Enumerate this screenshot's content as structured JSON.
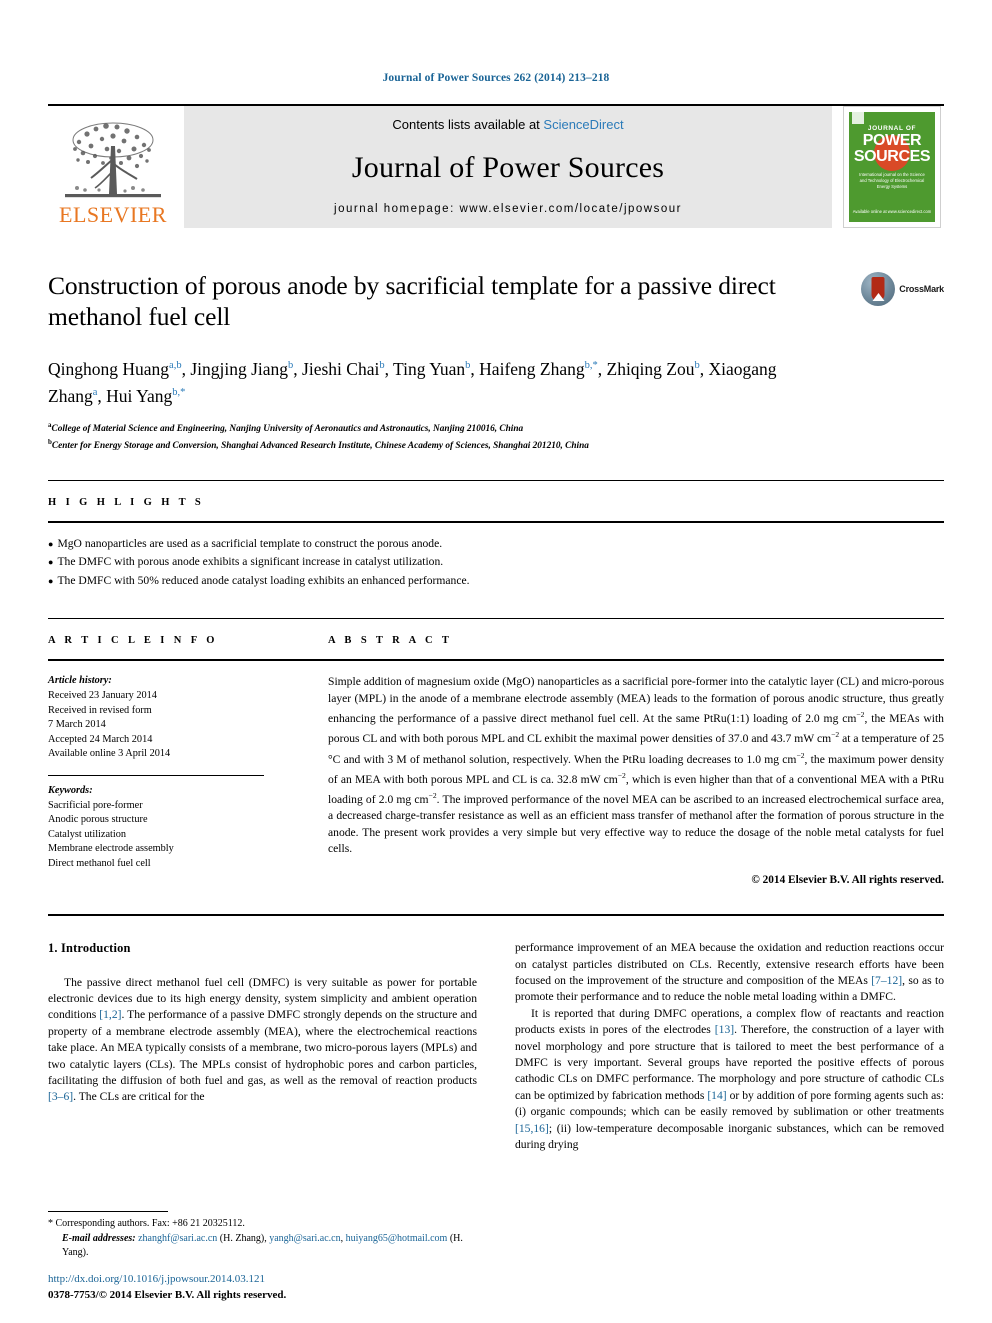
{
  "running_head": "Journal of Power Sources 262 (2014) 213–218",
  "masthead": {
    "contents_prefix": "Contents lists available at ",
    "sciencedirect": "ScienceDirect",
    "journal_name": "Journal of Power Sources",
    "homepage": "journal homepage: www.elsevier.com/locate/jpowsour",
    "publisher": "ELSEVIER",
    "cover": {
      "journal_of": "JOURNAL OF",
      "power": "POWER",
      "sources": "SOURCES",
      "subtitle": "International journal on the Science and Technology of Electrochemical Energy Systems",
      "footer": "Available online at www.sciencedirect.com"
    }
  },
  "crossmark": {
    "label": "CrossMark"
  },
  "article": {
    "title": "Construction of porous anode by sacrificial template for a passive direct methanol fuel cell",
    "authors_line1": "Qinghong Huang",
    "authors_html_note": "authors rendered from parts",
    "author_parts": [
      {
        "name": "Qinghong Huang",
        "sup": "a,b",
        "sep": ", "
      },
      {
        "name": "Jingjing Jiang",
        "sup": "b",
        "sep": ", "
      },
      {
        "name": "Jieshi Chai",
        "sup": "b",
        "sep": ", "
      },
      {
        "name": "Ting Yuan",
        "sup": "b",
        "sep": ", "
      },
      {
        "name": "Haifeng Zhang",
        "sup": "b,*",
        "sep": ", "
      },
      {
        "name": "Zhiqing Zou",
        "sup": "b",
        "sep": ", "
      },
      {
        "name": "Xiaogang Zhang",
        "sup": "a",
        "sep": ", "
      },
      {
        "name": "Hui Yang",
        "sup": "b,*",
        "sep": ""
      }
    ],
    "affiliation_a": "College of Material Science and Engineering, Nanjing University of Aeronautics and Astronautics, Nanjing 210016, China",
    "affiliation_a_sup": "a",
    "affiliation_b": "Center for Energy Storage and Conversion, Shanghai Advanced Research Institute, Chinese Academy of Sciences, Shanghai 201210, China",
    "affiliation_b_sup": "b"
  },
  "highlights": {
    "heading": "H I G H L I G H T S",
    "bullet": "●",
    "items": [
      "MgO nanoparticles are used as a sacrificial template to construct the porous anode.",
      "The DMFC with porous anode exhibits a significant increase in catalyst utilization.",
      "The DMFC with 50% reduced anode catalyst loading exhibits an enhanced performance."
    ]
  },
  "article_info": {
    "heading": "A R T I C L E  I N F O",
    "history_label": "Article history:",
    "history": [
      "Received 23 January 2014",
      "Received in revised form",
      "7 March 2014",
      "Accepted 24 March 2014",
      "Available online 3 April 2014"
    ],
    "keywords_label": "Keywords:",
    "keywords": [
      "Sacrificial pore-former",
      "Anodic porous structure",
      "Catalyst utilization",
      "Membrane electrode assembly",
      "Direct methanol fuel cell"
    ]
  },
  "abstract": {
    "heading": "A B S T R A C T",
    "part1": "Simple addition of magnesium oxide (MgO) nanoparticles as a sacrificial pore-former into the catalytic layer (CL) and micro-porous layer (MPL) in the anode of a membrane electrode assembly (MEA) leads to the formation of porous anodic structure, thus greatly enhancing the performance of a passive direct methanol fuel cell. At the same PtRu(1:1) loading of 2.0 mg cm",
    "sup1": "−2",
    "part2": ", the MEAs with porous CL and with both porous MPL and CL exhibit the maximal power densities of 37.0 and 43.7 mW cm",
    "sup2": "−2",
    "part3": " at a temperature of 25 °C and with 3 M of methanol solution, respectively. When the PtRu loading decreases to 1.0 mg cm",
    "sup3": "−2",
    "part4": ", the maximum power density of an MEA with both porous MPL and CL is ca. 32.8 mW cm",
    "sup4": "−2",
    "part5": ", which is even higher than that of a conventional MEA with a PtRu loading of 2.0 mg cm",
    "sup5": "−2",
    "part6": ". The improved performance of the novel MEA can be ascribed to an increased electrochemical surface area, a decreased charge-transfer resistance as well as an efficient mass transfer of methanol after the formation of porous structure in the anode. The present work provides a very simple but very effective way to reduce the dosage of the noble metal catalysts for fuel cells.",
    "copyright": "© 2014 Elsevier B.V. All rights reserved."
  },
  "introduction": {
    "heading": "1.  Introduction",
    "left_p1_a": "The passive direct methanol fuel cell (DMFC) is very suitable as power for portable electronic devices due to its high energy density, system simplicity and ambient operation conditions ",
    "left_ref1": "[1,2]",
    "left_p1_b": ". The performance of a passive DMFC strongly depends on the structure and property of a membrane electrode assembly (MEA), where the electrochemical reactions take place. An MEA typically consists of a membrane, two micro-porous layers (MPLs) and two catalytic layers (CLs). The MPLs consist of hydrophobic pores and carbon particles, facilitating the diffusion of both fuel and gas, as well as the removal of reaction products ",
    "left_ref2": "[3–6]",
    "left_p1_c": ". The CLs are critical for the",
    "right_p1_a": "performance improvement of an MEA because the oxidation and reduction reactions occur on catalyst particles distributed on CLs. Recently, extensive research efforts have been focused on the improvement of the structure and composition of the MEAs ",
    "right_ref1": "[7–12]",
    "right_p1_b": ", so as to promote their performance and to reduce the noble metal loading within a DMFC.",
    "right_p2_a": "It is reported that during DMFC operations, a complex flow of reactants and reaction products exists in pores of the electrodes ",
    "right_ref2": "[13]",
    "right_p2_b": ". Therefore, the construction of a layer with novel morphology and pore structure that is tailored to meet the best performance of a DMFC is very important. Several groups have reported the positive effects of porous cathodic CLs on DMFC performance. The morphology and pore structure of cathodic CLs can be optimized by fabrication methods ",
    "right_ref3": "[14]",
    "right_p2_c": " or by addition of pore forming agents such as: (i) organic compounds; which can be easily removed by sublimation or other treatments ",
    "right_ref4": "[15,16]",
    "right_p2_d": "; (ii) low-temperature decomposable inorganic substances, which can be removed during drying"
  },
  "footnote": {
    "star": "*",
    "corresponding": "Corresponding authors. Fax: +86 21 20325112.",
    "email_label": "E-mail addresses:",
    "email1": "zhanghf@sari.ac.cn",
    "email1_owner": "(H. Zhang),",
    "email2": "yangh@sari.ac.cn",
    "email2_sep": ",",
    "email3": "huiyang65@hotmail.com",
    "email3_owner": "(H. Yang)."
  },
  "footer": {
    "doi": "http://dx.doi.org/10.1016/j.jpowsour.2014.03.121",
    "issn": "0378-7753/© 2014 Elsevier B.V. All rights reserved."
  },
  "colors": {
    "link": "#1a6496",
    "sciencedirect": "#2b7bb9",
    "elsevier_orange": "#E87722",
    "cover_green": "#4e9a2f",
    "cover_red": "#d94a27"
  }
}
